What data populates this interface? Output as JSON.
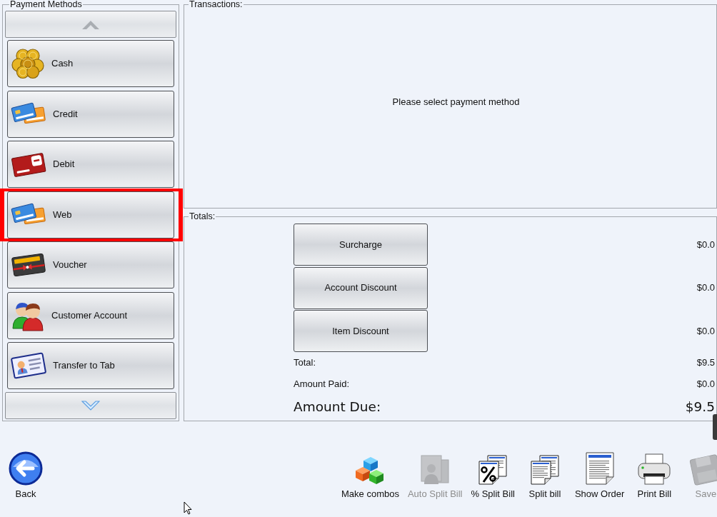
{
  "payment_methods": {
    "title": "Payment Methods",
    "scroll_up": {
      "disabled": true
    },
    "scroll_down": {
      "disabled": false
    },
    "items": [
      {
        "label": "Cash",
        "kind": "coins",
        "highlighted": false
      },
      {
        "label": "Credit",
        "kind": "card",
        "highlighted": false
      },
      {
        "label": "Debit",
        "kind": "eftpos",
        "highlighted": false
      },
      {
        "label": "Web",
        "kind": "card",
        "highlighted": true
      },
      {
        "label": "Voucher",
        "kind": "voucher",
        "highlighted": false
      },
      {
        "label": "Customer Account",
        "kind": "people",
        "highlighted": false
      },
      {
        "label": "Transfer to Tab",
        "kind": "id_card",
        "highlighted": false
      }
    ]
  },
  "transactions": {
    "title": "Transactions:",
    "message": "Please select payment method"
  },
  "totals": {
    "title": "Totals:",
    "adjustments": [
      {
        "label": "Surcharge",
        "amount": "$0.0"
      },
      {
        "label": "Account Discount",
        "amount": "$0.0"
      },
      {
        "label": "Item Discount",
        "amount": "$0.0"
      }
    ],
    "summary": [
      {
        "label": "Total:",
        "amount": "$9.5",
        "kind": "normal"
      },
      {
        "label": "Amount Paid:",
        "amount": "$0.0",
        "kind": "normal"
      },
      {
        "label": "Amount Due:",
        "amount": "$9.5",
        "kind": "large"
      }
    ]
  },
  "toolbar": {
    "back": {
      "label": "Back"
    },
    "actions": [
      {
        "label": "Make combos",
        "kind": "cubes",
        "disabled": false
      },
      {
        "label": "Auto Split Bill",
        "kind": "auto_split",
        "disabled": true
      },
      {
        "label": "% Split Bill",
        "kind": "percent_split",
        "disabled": false
      },
      {
        "label": "Split bill",
        "kind": "split",
        "disabled": false
      },
      {
        "label": "Show Order",
        "kind": "document",
        "disabled": false
      },
      {
        "label": "Print Bill",
        "kind": "printer",
        "disabled": false
      },
      {
        "label": "Save",
        "kind": "disk",
        "disabled": true
      }
    ]
  }
}
